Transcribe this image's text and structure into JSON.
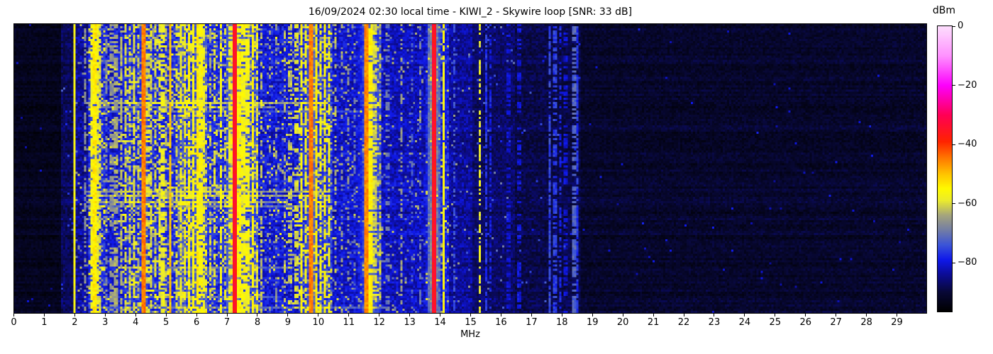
{
  "chart_data": {
    "type": "heatmap",
    "title": "16/09/2024 02:30 local time - KIWI_2 - Skywire loop [SNR: 33 dB]",
    "xlabel": "MHz",
    "x_range": [
      0,
      30
    ],
    "x_ticks": [
      "0",
      "1",
      "2",
      "3",
      "4",
      "5",
      "6",
      "7",
      "8",
      "9",
      "10",
      "11",
      "12",
      "13",
      "14",
      "15",
      "16",
      "17",
      "18",
      "19",
      "20",
      "21",
      "22",
      "23",
      "24",
      "25",
      "26",
      "27",
      "28",
      "29"
    ],
    "y_ticks": [],
    "colorbar": {
      "label": "dBm",
      "tick_labels": [
        "0",
        "−20",
        "−40",
        "−60",
        "−80"
      ],
      "tick_values": [
        0,
        -20,
        -40,
        -60,
        -80
      ],
      "range": [
        -96.5,
        0
      ]
    },
    "colormap": [
      [
        -96.5,
        [
          0,
          0,
          0
        ]
      ],
      [
        -90,
        [
          8,
          8,
          55
        ]
      ],
      [
        -84,
        [
          12,
          12,
          150
        ]
      ],
      [
        -79,
        [
          15,
          25,
          235
        ]
      ],
      [
        -74,
        [
          60,
          85,
          215
        ]
      ],
      [
        -69,
        [
          115,
          125,
          165
        ]
      ],
      [
        -64,
        [
          165,
          165,
          125
        ]
      ],
      [
        -59,
        [
          235,
          235,
          45
        ]
      ],
      [
        -55,
        [
          255,
          250,
          0
        ]
      ],
      [
        -50,
        [
          255,
          195,
          0
        ]
      ],
      [
        -45,
        [
          255,
          125,
          0
        ]
      ],
      [
        -39,
        [
          255,
          35,
          0
        ]
      ],
      [
        -30,
        [
          255,
          0,
          85
        ]
      ],
      [
        -20,
        [
          252,
          0,
          252
        ]
      ],
      [
        -10,
        [
          255,
          145,
          255
        ]
      ],
      [
        0,
        [
          253,
          222,
          253
        ]
      ]
    ],
    "grid": {
      "cols": 430,
      "rows": 137
    },
    "seed": 1337,
    "noise_regions_format": "[f0_MHz, f1_MHz, mean_dBm, spread_dB, speck_prob, speck_lo_dBm, speck_hi_dBm]",
    "noise_regions": [
      [
        0,
        1.55,
        -93,
        3,
        0.003,
        -86,
        -80
      ],
      [
        1.55,
        2.05,
        -88,
        5,
        0.012,
        -80,
        -72
      ],
      [
        2.05,
        2.45,
        -84,
        7,
        0.05,
        -72,
        -60
      ],
      [
        2.45,
        3.0,
        -78,
        8,
        0.25,
        -68,
        -54
      ],
      [
        3.0,
        3.6,
        -80,
        8,
        0.13,
        -70,
        -57
      ],
      [
        3.6,
        4.6,
        -78,
        8,
        0.22,
        -68,
        -55
      ],
      [
        4.6,
        5.35,
        -78,
        8,
        0.2,
        -68,
        -55
      ],
      [
        5.35,
        6.35,
        -74,
        9,
        0.32,
        -66,
        -53
      ],
      [
        6.35,
        7.1,
        -78,
        8,
        0.16,
        -68,
        -56
      ],
      [
        7.1,
        8.05,
        -74,
        9,
        0.3,
        -66,
        -53
      ],
      [
        8.05,
        9.35,
        -80,
        8,
        0.09,
        -70,
        -57
      ],
      [
        9.35,
        10.45,
        -77,
        8,
        0.22,
        -67,
        -55
      ],
      [
        10.45,
        11.5,
        -81,
        7,
        0.07,
        -71,
        -60
      ],
      [
        11.5,
        12.1,
        -75,
        8,
        0.22,
        -66,
        -55
      ],
      [
        12.1,
        13.55,
        -82,
        7,
        0.05,
        -72,
        -62
      ],
      [
        13.55,
        14.3,
        -79,
        7,
        0.09,
        -69,
        -58
      ],
      [
        14.3,
        15.1,
        -84,
        6,
        0.03,
        -74,
        -64
      ],
      [
        15.1,
        16.5,
        -87,
        5,
        0.015,
        -78,
        -68
      ],
      [
        16.5,
        18.6,
        -89,
        5,
        0.008,
        -80,
        -73
      ],
      [
        18.6,
        30,
        -91.5,
        4,
        0.002,
        -84,
        -78
      ]
    ],
    "carriers_format": "[f_MHz, level_dBm, halfwidth_MHz, row_solidity_0to1]",
    "carriers": [
      [
        1.97,
        -57,
        0.04,
        1
      ],
      [
        2.33,
        -67,
        0.04,
        0.55
      ],
      [
        2.55,
        -57,
        0.04,
        0.85
      ],
      [
        2.63,
        -54,
        0.07,
        0.95
      ],
      [
        2.73,
        -59,
        0.04,
        0.8
      ],
      [
        2.83,
        -60,
        0.04,
        0.6
      ],
      [
        3.05,
        -68,
        0.04,
        0.4
      ],
      [
        3.21,
        -66,
        0.04,
        0.5
      ],
      [
        3.35,
        -64,
        0.04,
        0.5
      ],
      [
        3.5,
        -62,
        0.04,
        0.6
      ],
      [
        3.64,
        -60,
        0.04,
        0.65
      ],
      [
        3.8,
        -61,
        0.04,
        0.6
      ],
      [
        3.92,
        -59,
        0.04,
        0.7
      ],
      [
        4.06,
        -62,
        0.04,
        0.5
      ],
      [
        4.27,
        -45,
        0.07,
        1
      ],
      [
        4.4,
        -60,
        0.04,
        0.5
      ],
      [
        4.5,
        -60,
        0.04,
        0.55
      ],
      [
        4.62,
        -61,
        0.04,
        0.5
      ],
      [
        4.76,
        -59,
        0.04,
        0.6
      ],
      [
        4.88,
        -58,
        0.04,
        0.65
      ],
      [
        5.01,
        -62,
        0.04,
        0.5
      ],
      [
        5.13,
        -50,
        0.05,
        0.95
      ],
      [
        5.32,
        -60,
        0.04,
        0.55
      ],
      [
        5.45,
        -58,
        0.04,
        0.6
      ],
      [
        5.62,
        -57,
        0.04,
        0.7
      ],
      [
        5.76,
        -55,
        0.04,
        0.8
      ],
      [
        5.9,
        -56,
        0.04,
        0.8
      ],
      [
        6.03,
        -54,
        0.06,
        0.9
      ],
      [
        6.14,
        -56,
        0.04,
        0.8
      ],
      [
        6.24,
        -58,
        0.04,
        0.7
      ],
      [
        6.44,
        -62,
        0.04,
        0.5
      ],
      [
        6.6,
        -60,
        0.04,
        0.5
      ],
      [
        6.8,
        -57,
        0.04,
        0.75
      ],
      [
        6.97,
        -62,
        0.04,
        0.4
      ],
      [
        7.12,
        -58,
        0.04,
        0.6
      ],
      [
        7.26,
        -35,
        0.07,
        1
      ],
      [
        7.4,
        -55,
        0.04,
        0.8
      ],
      [
        7.53,
        -57,
        0.04,
        0.7
      ],
      [
        7.67,
        -57,
        0.04,
        0.7
      ],
      [
        7.82,
        -55,
        0.04,
        0.8
      ],
      [
        7.97,
        -60,
        0.04,
        0.5
      ],
      [
        8.14,
        -62,
        0.04,
        0.4
      ],
      [
        8.38,
        -65,
        0.04,
        0.3
      ],
      [
        8.62,
        -67,
        0.04,
        0.25
      ],
      [
        8.87,
        -63,
        0.04,
        0.35
      ],
      [
        9.07,
        -62,
        0.04,
        0.4
      ],
      [
        9.28,
        -60,
        0.04,
        0.45
      ],
      [
        9.47,
        -55,
        0.04,
        0.8
      ],
      [
        9.6,
        -57,
        0.04,
        0.6
      ],
      [
        9.8,
        -45,
        0.07,
        1
      ],
      [
        9.94,
        -54,
        0.04,
        0.85
      ],
      [
        10.07,
        -57,
        0.04,
        0.7
      ],
      [
        10.2,
        -55,
        0.04,
        0.8
      ],
      [
        10.37,
        -57,
        0.04,
        0.6
      ],
      [
        10.57,
        -63,
        0.04,
        0.4
      ],
      [
        10.78,
        -65,
        0.04,
        0.3
      ],
      [
        10.98,
        -67,
        0.04,
        0.3
      ],
      [
        11.18,
        -70,
        0.04,
        0.3
      ],
      [
        11.59,
        -46,
        0.06,
        1
      ],
      [
        11.72,
        -55,
        0.04,
        0.9
      ],
      [
        11.86,
        -61,
        0.04,
        0.6
      ],
      [
        12.02,
        -63,
        0.04,
        0.4
      ],
      [
        12.28,
        -70,
        0.04,
        0.3
      ],
      [
        12.73,
        -65,
        0.04,
        0.5
      ],
      [
        13.07,
        -72,
        0.04,
        0.35
      ],
      [
        13.38,
        -70,
        0.04,
        0.3
      ],
      [
        13.8,
        -35,
        0.06,
        1
      ],
      [
        14.12,
        -56,
        0.04,
        0.95
      ],
      [
        14.48,
        -74,
        0.04,
        0.4
      ],
      [
        15.33,
        -59,
        0.04,
        0.55
      ],
      [
        15.52,
        -77,
        0.05,
        0.7
      ],
      [
        15.68,
        -79,
        0.05,
        0.6
      ],
      [
        16.25,
        -81,
        0.05,
        0.5
      ],
      [
        16.6,
        -80,
        0.05,
        0.5
      ],
      [
        17.62,
        -75,
        0.05,
        0.8
      ],
      [
        17.8,
        -76,
        0.05,
        0.7
      ],
      [
        17.95,
        -78,
        0.05,
        0.5
      ],
      [
        18.15,
        -81,
        0.05,
        0.5
      ],
      [
        18.42,
        -72,
        0.05,
        0.6
      ],
      [
        18.52,
        -77,
        0.05,
        0.8
      ]
    ],
    "halos_format": "[f_MHz, halfwidth_MHz, peak_dBm]",
    "halos": [
      [
        7.26,
        0.28,
        -64
      ],
      [
        9.8,
        0.18,
        -67
      ],
      [
        11.65,
        0.35,
        -70
      ],
      [
        13.8,
        0.22,
        -63
      ],
      [
        2.63,
        0.2,
        -70
      ],
      [
        4.27,
        0.15,
        -68
      ],
      [
        6.03,
        0.3,
        -72
      ]
    ],
    "streaks_format": "[row_fraction, f0_MHz, f1_MHz, boost_dB]",
    "streaks": [
      [
        0.275,
        2.4,
        10.3,
        15
      ],
      [
        0.29,
        2.4,
        8.6,
        11
      ],
      [
        0.305,
        2.9,
        11.9,
        7
      ],
      [
        0.578,
        2.4,
        10.4,
        13
      ],
      [
        0.595,
        2.4,
        10.4,
        15
      ],
      [
        0.615,
        2.4,
        9.0,
        11
      ],
      [
        0.632,
        2.4,
        10.4,
        9
      ],
      [
        0.845,
        3.5,
        9.2,
        8
      ],
      [
        0.862,
        4.0,
        8.0,
        6
      ],
      [
        0.948,
        4.2,
        8.6,
        7
      ],
      [
        0.985,
        2.5,
        12.0,
        8
      ]
    ]
  }
}
